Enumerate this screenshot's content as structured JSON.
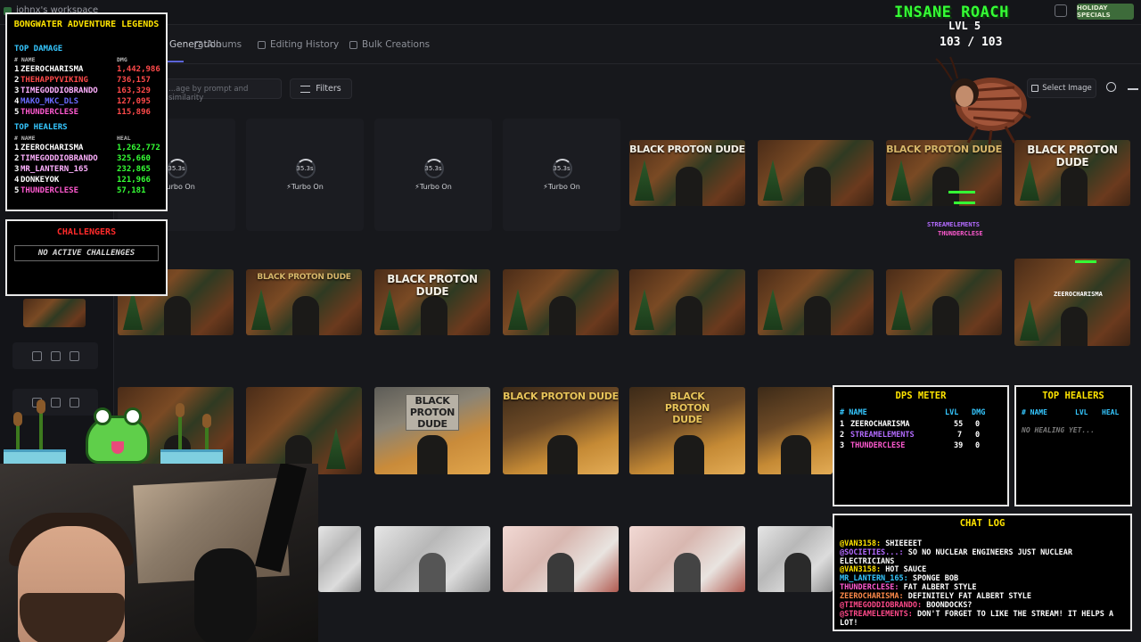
{
  "app": {
    "workspace": "johnx's workspace",
    "holiday_button": "HOLIDAY SPECIALS"
  },
  "tabs": [
    {
      "label": "Generation",
      "active": true
    },
    {
      "label": "Albums"
    },
    {
      "label": "Editing History"
    },
    {
      "label": "Bulk Creations"
    }
  ],
  "toolbar": {
    "search_placeholder": "...age by prompt and similarity",
    "filters_label": "Filters",
    "select_image_label": "Select Image"
  },
  "pending": [
    {
      "time": "35.3s",
      "turbo": "Turbo On"
    },
    {
      "time": "35.3s",
      "turbo": "Turbo On"
    },
    {
      "time": "35.3s",
      "turbo": "Turbo On"
    },
    {
      "time": "35.3s",
      "turbo": "Turbo On"
    }
  ],
  "image_captions": {
    "row1": [
      "BLACK PROTON DUDE",
      "BLACK PROTON DUDE",
      "BLACK PROTON DUDE",
      "BLACK PROTON DUDE"
    ],
    "row2": [
      "BLACK PROTON DUDE",
      "BLACK PROTON DUDE",
      "BLACK PROTON DUDE"
    ],
    "row3": [
      "BLACK PROTON DUDE",
      "BLACK PROTON DUDE",
      "BLACK PROTON DUDE"
    ]
  },
  "leaderboard": {
    "title": "BONGWATER ADVENTURE LEGENDS",
    "damage_heading": "TOP DAMAGE",
    "healers_heading": "TOP HEALERS",
    "col_name": "# NAME",
    "col_dmg": "DMG",
    "col_heal": "HEAL",
    "damage": [
      {
        "rank": "1",
        "name": "ZEEROCHARISMA",
        "value": "1,442,986",
        "color": "#ffffff"
      },
      {
        "rank": "2",
        "name": "THEHAPPYVIKING",
        "value": "736,157",
        "color": "#ff4a4a"
      },
      {
        "rank": "3",
        "name": "TIMEGODDIOBRANDO",
        "value": "163,329",
        "color": "#ffb0ff"
      },
      {
        "rank": "4",
        "name": "MAKO_MKC_DLS",
        "value": "127,095",
        "color": "#6a6aff"
      },
      {
        "rank": "5",
        "name": "THUNDERCLESE",
        "value": "115,896",
        "color": "#ff5ad0"
      }
    ],
    "healers": [
      {
        "rank": "1",
        "name": "ZEEROCHARISMA",
        "value": "1,262,772",
        "color": "#ffffff"
      },
      {
        "rank": "2",
        "name": "TIMEGODDIOBRANDO",
        "value": "325,660",
        "color": "#ffb0ff"
      },
      {
        "rank": "3",
        "name": "MR_LANTERN_165",
        "value": "232,865",
        "color": "#ffb0ff"
      },
      {
        "rank": "4",
        "name": "DONKEYOK",
        "value": "121,966",
        "color": "#ffffff"
      },
      {
        "rank": "5",
        "name": "THUNDERCLESE",
        "value": "57,181",
        "color": "#ff5ad0"
      }
    ],
    "damage_value_color": "#ff4a4a",
    "heal_value_color": "#35ff35"
  },
  "challengers": {
    "title": "CHALLENGERS",
    "empty": "NO ACTIVE CHALLENGES"
  },
  "boss": {
    "name": "INSANE ROACH",
    "level": "LVL 5",
    "hp": "103 / 103"
  },
  "floaters": [
    {
      "name": "STREAMELEMENTS",
      "color": "#b36bff"
    },
    {
      "name": "THUNDERCLESE",
      "color": "#ff5ad0"
    },
    {
      "name": "ZEEROCHARISMA",
      "color": "#ffffff"
    }
  ],
  "dps_meter": {
    "title": "DPS METER",
    "col_name": "# NAME",
    "col_lvl": "LVL",
    "col_dmg": "DMG",
    "rows": [
      {
        "rank": "1",
        "name": "ZEEROCHARISMA",
        "lvl": "55",
        "dmg": "0",
        "color": "#ffffff"
      },
      {
        "rank": "2",
        "name": "STREAMELEMENTS",
        "lvl": "7",
        "dmg": "0",
        "color": "#b36bff"
      },
      {
        "rank": "3",
        "name": "THUNDERCLESE",
        "lvl": "39",
        "dmg": "0",
        "color": "#ff5ad0"
      }
    ]
  },
  "top_healers_panel": {
    "title": "TOP HEALERS",
    "col_name": "# NAME",
    "col_lvl": "LVL",
    "col_heal": "HEAL",
    "empty": "NO HEALING YET..."
  },
  "chat": {
    "title": "CHAT LOG",
    "messages": [
      {
        "user": "@VAN3158:",
        "text": "SHIEEEET",
        "color": "#ffe400"
      },
      {
        "user": "@SOCIETIES...:",
        "text": "SO NO NUCLEAR ENGINEERS JUST NUCLEAR ELECTRICIANS",
        "color": "#b36bff"
      },
      {
        "user": "@VAN3158:",
        "text": "HOT SAUCE",
        "color": "#ffe400"
      },
      {
        "user": "MR_LANTERN_165:",
        "text": "SPONGE BOB",
        "color": "#35c7ff"
      },
      {
        "user": "THUNDERCLESE:",
        "text": "FAT ALBERT STYLE",
        "color": "#ff5ad0"
      },
      {
        "user": "ZEEROCHARISMA:",
        "text": "DEFINITELY FAT ALBERT STYLE",
        "color": "#ffffff"
      },
      {
        "user": "@TIMEGODDIOBRANDO:",
        "text": "BOONDOCKS?",
        "color": "#ff4a8a"
      },
      {
        "user": "@STREAMELEMENTS:",
        "text": "DON'T FORGET TO LIKE THE STREAM! IT HELPS A LOT!",
        "color": "#ff4a8a"
      }
    ]
  },
  "colors": {
    "accent": "#5b64d8",
    "panel_border": "#e8e8e8",
    "boss_name": "#35ff35",
    "title_yellow": "#ffe400",
    "heading_cyan": "#35c7ff",
    "challengers_red": "#ff2a2a"
  }
}
